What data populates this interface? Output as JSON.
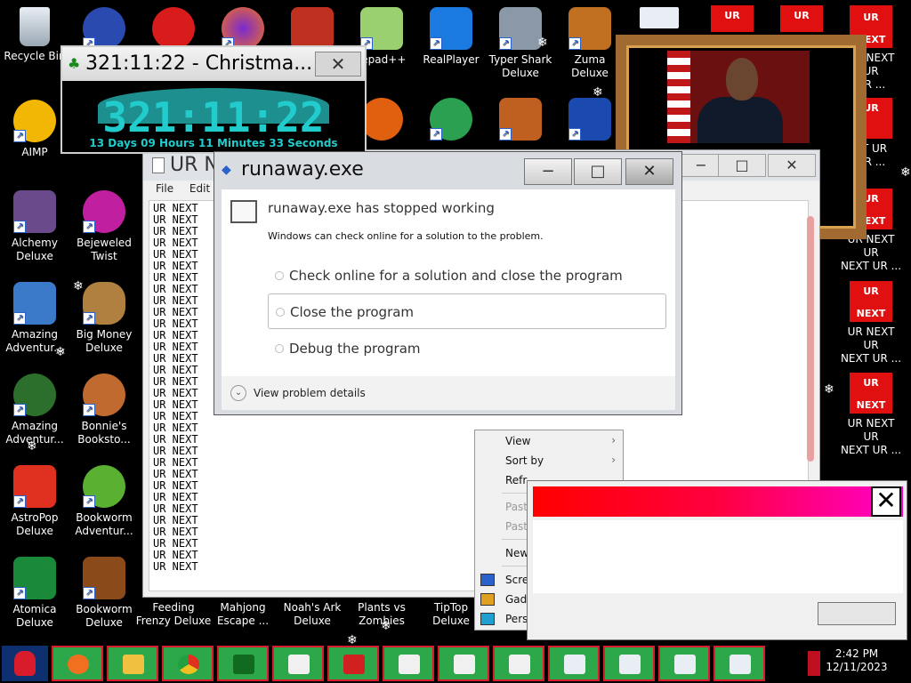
{
  "desktop": {
    "icons": [
      {
        "label1": "Recycle Bin",
        "label2": ""
      },
      {
        "label1": "AIMP",
        "label2": ""
      },
      {
        "label1": "Alchemy",
        "label2": "Deluxe"
      },
      {
        "label1": "Amazing",
        "label2": "Adventur..."
      },
      {
        "label1": "Amazing",
        "label2": "Adventur..."
      },
      {
        "label1": "AstroPop",
        "label2": "Deluxe"
      },
      {
        "label1": "Atomica",
        "label2": "Deluxe"
      },
      {
        "label1": "Bejeweled",
        "label2": "Twist"
      },
      {
        "label1": "Big Money",
        "label2": "Deluxe"
      },
      {
        "label1": "Bonnie's",
        "label2": "Booksto..."
      },
      {
        "label1": "Bookworm",
        "label2": "Adventur..."
      },
      {
        "label1": "Bookworm",
        "label2": "Deluxe"
      },
      {
        "label1": "Feeding",
        "label2": "Frenzy Deluxe"
      },
      {
        "label1": "Mahjong",
        "label2": "Escape ..."
      },
      {
        "label1": "Noah's Ark",
        "label2": "Deluxe"
      },
      {
        "label1": "Plants vs",
        "label2": "Zombies"
      },
      {
        "label1": "TipTop",
        "label2": "Deluxe"
      },
      {
        "label1": "tepad++",
        "label2": ""
      },
      {
        "label1": "RealPlayer",
        "label2": ""
      },
      {
        "label1": "Typer Shark",
        "label2": "Deluxe"
      },
      {
        "label1": "Zuma Deluxe",
        "label2": ""
      },
      {
        "label1": "Deluxe",
        "label2": ""
      }
    ],
    "ur_icons": [
      {
        "top": "UR",
        "bottom": "NEXT",
        "label1": "UR NEXT UR",
        "label2": "UR ..."
      },
      {
        "top": "UR",
        "bottom": "",
        "label1": "XT UR",
        "label2": "UR ..."
      },
      {
        "top": "UR",
        "bottom": "NEXT",
        "label1": "UR NEXT UR",
        "label2": "NEXT UR ..."
      },
      {
        "top": "UR",
        "bottom": "NEXT",
        "label1": "UR NEXT UR",
        "label2": "NEXT UR ..."
      },
      {
        "top": "UR",
        "bottom": "NEXT",
        "label1": "UR NEXT UR",
        "label2": "NEXT UR ..."
      }
    ],
    "ur_top_tiles": [
      "UR",
      "UR",
      "UR"
    ]
  },
  "countdown": {
    "title": "321:11:22 - Christma...",
    "big_time": "321:11:22",
    "detail": "13 Days 09 Hours 11 Minutes 33 Seconds",
    "close": "✕"
  },
  "notepad": {
    "title": "UR N",
    "menu": [
      "File",
      "Edit"
    ],
    "line_text": "UR  NEXT",
    "line_count": 32
  },
  "dialog": {
    "title": "runaway.exe",
    "heading": "runaway.exe has stopped working",
    "subtext": "Windows can check online for a solution to the problem.",
    "options": [
      "Check online for a solution and close the program",
      "Close the program",
      "Debug the program"
    ],
    "details": "View problem details",
    "minimize": "−",
    "maximize": "□",
    "close": "✕"
  },
  "context_menu": {
    "items": [
      {
        "label": "View",
        "disabled": false,
        "submenu": true
      },
      {
        "label": "Sort by",
        "disabled": false,
        "submenu": true
      },
      {
        "label": "Refr",
        "disabled": false,
        "submenu": false
      },
      {
        "label": "Past",
        "disabled": true,
        "submenu": false
      },
      {
        "label": "Past",
        "disabled": true,
        "submenu": false
      },
      {
        "label": "New",
        "disabled": false,
        "submenu": false
      },
      {
        "label": "Scre",
        "disabled": false,
        "submenu": false
      },
      {
        "label": "Gadg",
        "disabled": false,
        "submenu": false
      },
      {
        "label": "Pers",
        "disabled": false,
        "submenu": false
      }
    ]
  },
  "popup": {
    "close": "✕"
  },
  "taskbar": {
    "time": "2:42 PM",
    "date": "12/11/2023"
  }
}
